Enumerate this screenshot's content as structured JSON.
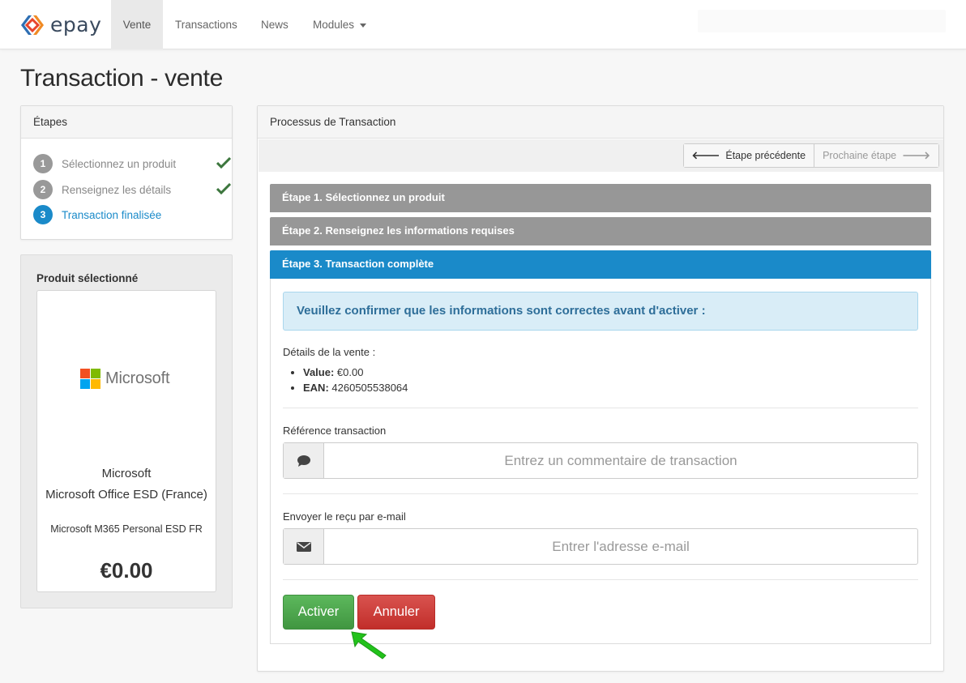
{
  "brand": {
    "name": "epay"
  },
  "nav": {
    "items": [
      {
        "label": "Vente",
        "active": true
      },
      {
        "label": "Transactions"
      },
      {
        "label": "News"
      },
      {
        "label": "Modules"
      }
    ]
  },
  "page": {
    "title": "Transaction - vente"
  },
  "steps_panel": {
    "title": "Étapes",
    "steps": [
      {
        "num": "1",
        "label": "Sélectionnez un produit",
        "done": true
      },
      {
        "num": "2",
        "label": "Renseignez les détails",
        "done": true
      },
      {
        "num": "3",
        "label": "Transaction finalisée",
        "active": true
      }
    ]
  },
  "product": {
    "panel_title": "Produit sélectionné",
    "logo_text": "Microsoft",
    "brand": "Microsoft",
    "name": "Microsoft Office ESD (France)",
    "sub": "Microsoft M365 Personal ESD FR",
    "price": "€0.00"
  },
  "process": {
    "title": "Processus de Transaction",
    "prev_label": "Étape précédente",
    "next_label": "Prochaine étape",
    "step1": "Étape 1. Sélectionnez un produit",
    "step2": "Étape 2. Renseignez les informations requises",
    "step3": "Étape 3. Transaction complète",
    "alert": "Veuillez confirmer que les informations sont correctes avant d'activer :",
    "details_title": "Détails de la vente :",
    "details": [
      {
        "key": "Value:",
        "value": "€0.00"
      },
      {
        "key": "EAN:",
        "value": "4260505538064"
      }
    ],
    "reference_label": "Référence transaction",
    "reference_placeholder": "Entrez un commentaire de transaction",
    "email_label": "Envoyer le reçu par e-mail",
    "email_placeholder": "Entrer l'adresse e-mail",
    "activate_label": "Activer",
    "cancel_label": "Annuler"
  },
  "colors": {
    "primary": "#1a8ac9",
    "success": "#4cae4c",
    "danger": "#d43f3a",
    "step_inactive": "#979797",
    "check": "#3c763d",
    "pointer_arrow": "#22c21b"
  }
}
